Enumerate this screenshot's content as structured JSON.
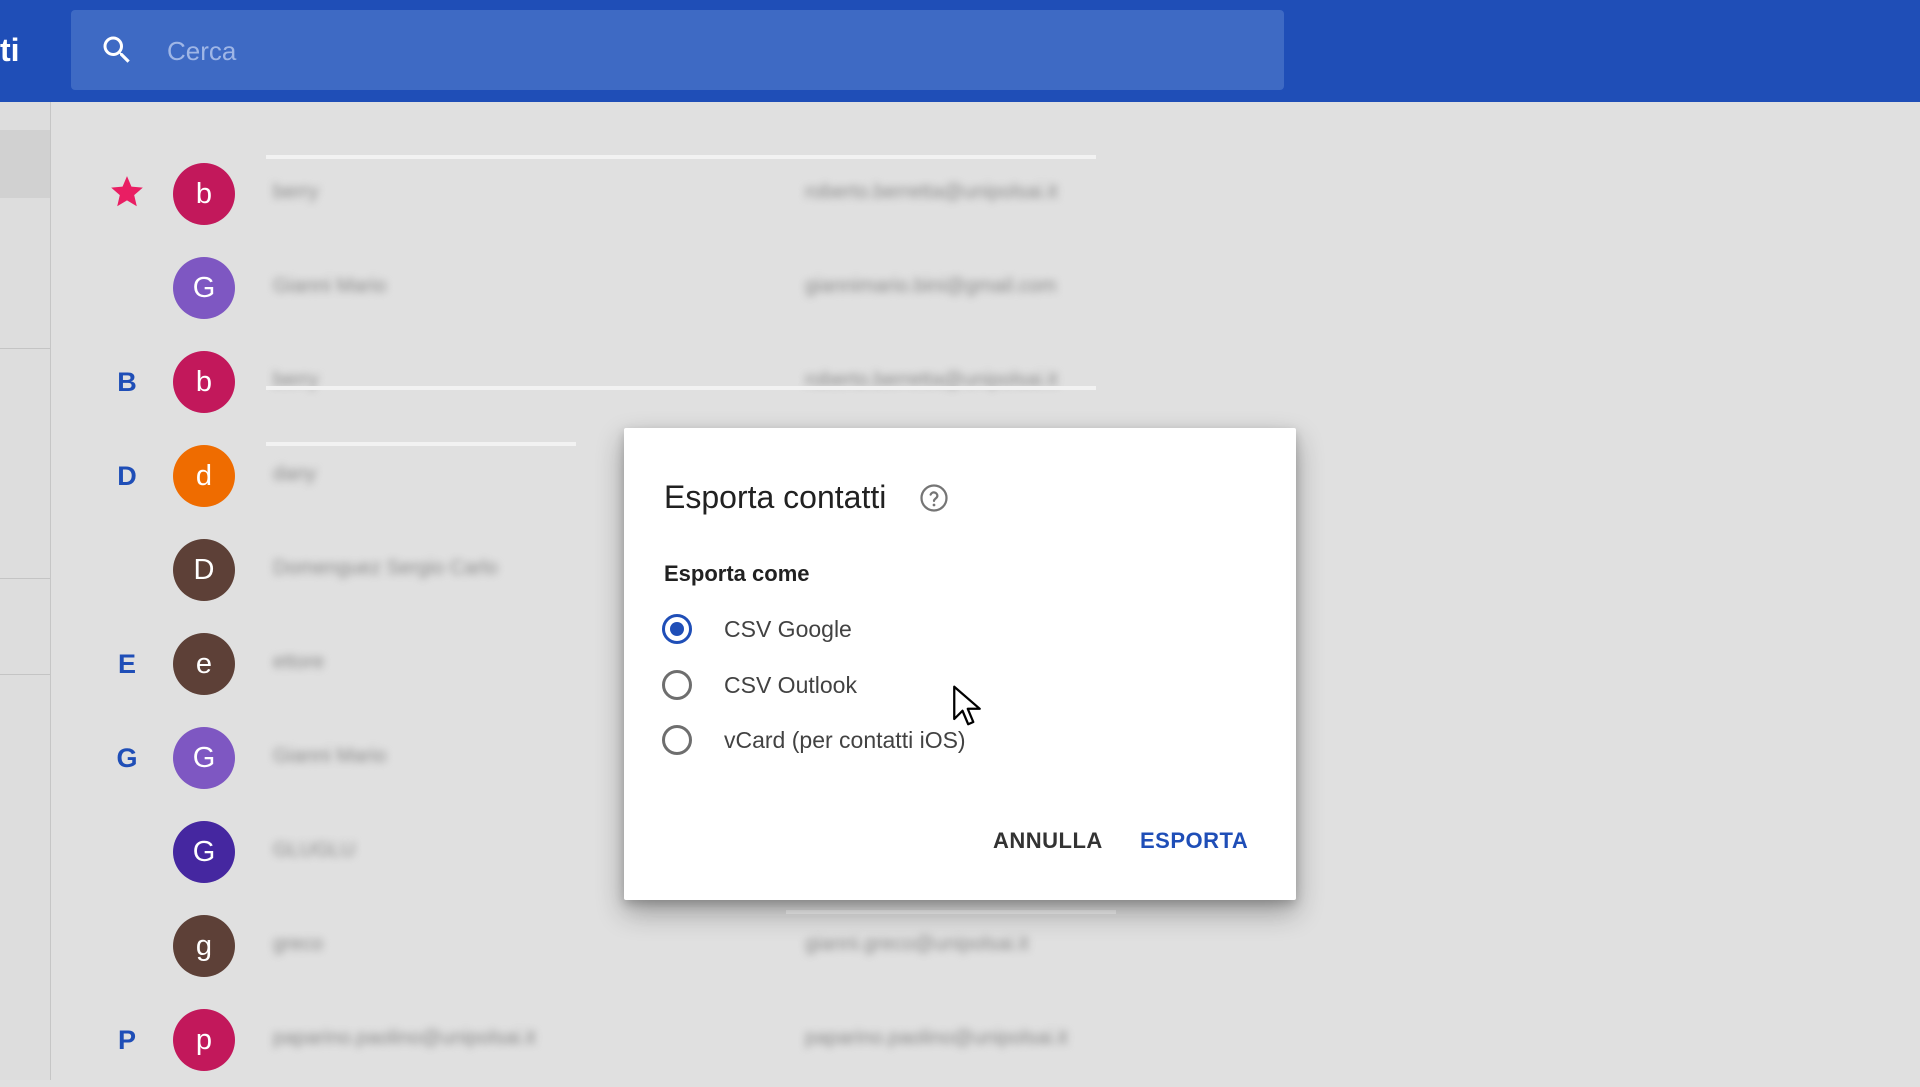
{
  "header": {
    "app_title_fragment": "ti",
    "search": {
      "placeholder": "Cerca",
      "value": ""
    }
  },
  "contacts": [
    {
      "section": "",
      "starred": true,
      "initial": "b",
      "avatar_color": "#c2185b",
      "name": "berry",
      "email": "roberto.berretta@unipolsai.it"
    },
    {
      "section": "",
      "starred": false,
      "initial": "G",
      "avatar_color": "#7e57c2",
      "name": "Gianni Mario",
      "email": "giannimario.bini@gmail.com"
    },
    {
      "section": "B",
      "starred": false,
      "initial": "b",
      "avatar_color": "#c2185b",
      "name": "berry",
      "email": "roberto.berretta@unipolsai.it"
    },
    {
      "section": "D",
      "starred": false,
      "initial": "d",
      "avatar_color": "#ef6c00",
      "name": "dany",
      "email": ""
    },
    {
      "section": "",
      "starred": false,
      "initial": "D",
      "avatar_color": "#5d4037",
      "name": "Domenguez Sergio Carlo",
      "email": ""
    },
    {
      "section": "E",
      "starred": false,
      "initial": "e",
      "avatar_color": "#5d4037",
      "name": "ettore",
      "email": ""
    },
    {
      "section": "G",
      "starred": false,
      "initial": "G",
      "avatar_color": "#7e57c2",
      "name": "Gianni Mario",
      "email": ""
    },
    {
      "section": "",
      "starred": false,
      "initial": "G",
      "avatar_color": "#4527a0",
      "name": "GLUGLU",
      "email": ""
    },
    {
      "section": "",
      "starred": false,
      "initial": "g",
      "avatar_color": "#5d4037",
      "name": "greco",
      "email": "gianni.greco@unipolsai.it"
    },
    {
      "section": "P",
      "starred": false,
      "initial": "p",
      "avatar_color": "#c2185b",
      "name": "paparino.paolino@unipolsai.it",
      "email": "paparino.paolino@unipolsai.it"
    }
  ],
  "dialog": {
    "title": "Esporta contatti",
    "section_label": "Esporta come",
    "options": [
      {
        "label": "CSV Google",
        "selected": true
      },
      {
        "label": "CSV Outlook",
        "selected": false
      },
      {
        "label": "vCard (per contatti iOS)",
        "selected": false
      }
    ],
    "cancel_label": "ANNULLA",
    "export_label": "ESPORTA"
  },
  "colors": {
    "primary": "#1f4eb7",
    "search_bg": "#3e6ac4",
    "star": "#e91e63",
    "background": "#e0e0e0"
  },
  "icons": {
    "search": "search-icon",
    "star": "star-icon",
    "help": "help-circle-icon",
    "cursor": "mouse-pointer-icon"
  }
}
